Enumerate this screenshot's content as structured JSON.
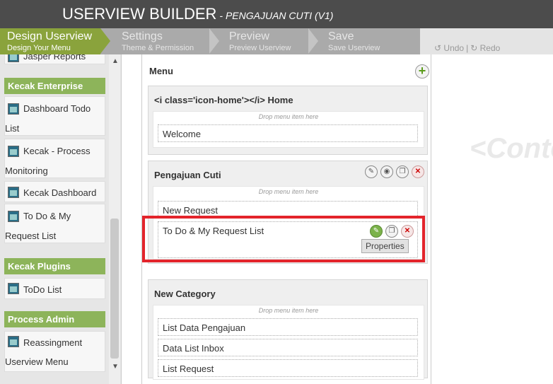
{
  "header": {
    "title": "USERVIEW BUILDER",
    "subtitle": "- PENGAJUAN CUTI (V1)"
  },
  "steps": [
    {
      "label": "Design Userview",
      "sub": "Design Your Menu"
    },
    {
      "label": "Settings",
      "sub": "Theme & Permission"
    },
    {
      "label": "Preview",
      "sub": "Preview Userview"
    },
    {
      "label": "Save",
      "sub": "Save Userview"
    }
  ],
  "toolbar": {
    "undo": "Undo",
    "sep": "|",
    "redo": "Redo"
  },
  "sidebar": {
    "clipped_item": "Jasper Reports",
    "cat1": "Kecak Enterprise",
    "i1a": "Dashboard Todo",
    "i1b": "List",
    "i2a": "Kecak - Process",
    "i2b": "Monitoring",
    "i3a": "Kecak Dashboard",
    "i4a": "To Do & My",
    "i4b": "Request List",
    "cat2": "Kecak Plugins",
    "i5a": "ToDo List",
    "cat3": "Process Admin",
    "i6a": "Reassingment",
    "i6b": "Userview Menu"
  },
  "canvas": {
    "menu_label": "Menu",
    "drop_hint": "Drop menu item here",
    "cat1_name": "<i class='icon-home'></i> Home",
    "cat1_items": [
      "Welcome"
    ],
    "cat2_name": "Pengajuan Cuti",
    "cat2_items": [
      "New Request",
      "To Do & My Request List"
    ],
    "cat3_name": "New Category",
    "cat3_items": [
      "List Data Pengajuan",
      "Data List Inbox",
      "List Request"
    ],
    "tooltip": "Properties"
  },
  "content_placeholder": "<Conte",
  "colors": {
    "header_bg": "#4c4c4c",
    "active_step": "#8aa33c",
    "category_head": "#8db45a",
    "highlight": "#e3242b"
  }
}
